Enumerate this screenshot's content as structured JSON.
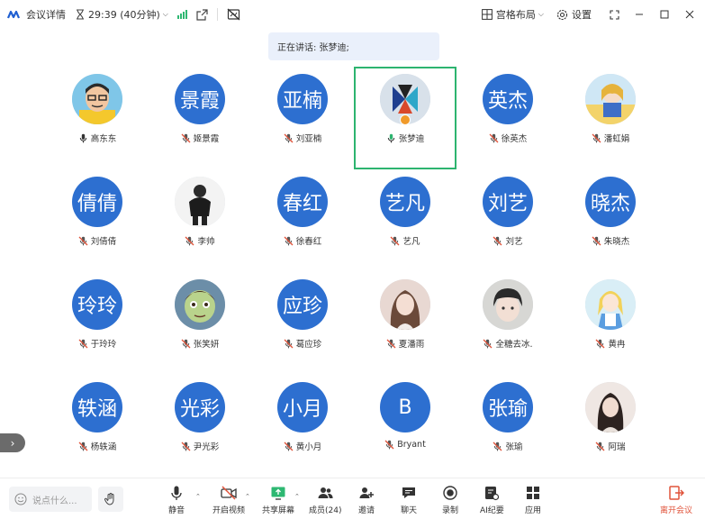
{
  "titlebar": {
    "meeting_details": "会议详情",
    "timer": "29:39 (40分钟)",
    "layout_label": "宫格布局",
    "settings_label": "设置"
  },
  "speaking": {
    "text": "正在讲话: 张梦迪;"
  },
  "participants": [
    {
      "name": "高东东",
      "avatar_text": "",
      "avatar_type": "photo-cartoon-man",
      "mic": "on"
    },
    {
      "name": "姬景霞",
      "avatar_text": "景霞",
      "avatar_type": "initials",
      "mic": "muted"
    },
    {
      "name": "刘亚楠",
      "avatar_text": "亚楠",
      "avatar_type": "initials",
      "mic": "muted"
    },
    {
      "name": "张梦迪",
      "avatar_text": "",
      "avatar_type": "photo-logo",
      "mic": "speaking",
      "active": true,
      "host": true
    },
    {
      "name": "徐英杰",
      "avatar_text": "英杰",
      "avatar_type": "initials",
      "mic": "muted"
    },
    {
      "name": "潘虹娟",
      "avatar_text": "",
      "avatar_type": "photo-anime",
      "mic": "muted"
    },
    {
      "name": "刘倩倩",
      "avatar_text": "倩倩",
      "avatar_type": "initials",
      "mic": "muted"
    },
    {
      "name": "李帅",
      "avatar_text": "",
      "avatar_type": "photo-person",
      "mic": "muted"
    },
    {
      "name": "徐春红",
      "avatar_text": "春红",
      "avatar_type": "initials",
      "mic": "muted"
    },
    {
      "name": "艺凡",
      "avatar_text": "艺凡",
      "avatar_type": "initials",
      "mic": "muted"
    },
    {
      "name": "刘艺",
      "avatar_text": "刘艺",
      "avatar_type": "initials",
      "mic": "muted"
    },
    {
      "name": "朱晓杰",
      "avatar_text": "晓杰",
      "avatar_type": "initials",
      "mic": "muted"
    },
    {
      "name": "于玲玲",
      "avatar_text": "玲玲",
      "avatar_type": "initials",
      "mic": "muted"
    },
    {
      "name": "张笑妍",
      "avatar_text": "",
      "avatar_type": "photo-cartoon-girl",
      "mic": "muted"
    },
    {
      "name": "葛应珍",
      "avatar_text": "应珍",
      "avatar_type": "initials",
      "mic": "muted"
    },
    {
      "name": "夏潘雨",
      "avatar_text": "",
      "avatar_type": "photo-woman",
      "mic": "muted"
    },
    {
      "name": "全糖去冰.",
      "avatar_text": "",
      "avatar_type": "photo-child",
      "mic": "muted"
    },
    {
      "name": "黄冉",
      "avatar_text": "",
      "avatar_type": "photo-alice",
      "mic": "muted"
    },
    {
      "name": "杨轶涵",
      "avatar_text": "轶涵",
      "avatar_type": "initials",
      "mic": "muted"
    },
    {
      "name": "尹光彩",
      "avatar_text": "光彩",
      "avatar_type": "initials",
      "mic": "muted"
    },
    {
      "name": "黄小月",
      "avatar_text": "小月",
      "avatar_type": "initials",
      "mic": "muted"
    },
    {
      "name": "Bryant",
      "avatar_text": "B",
      "avatar_type": "initials",
      "mic": "muted"
    },
    {
      "name": "张瑜",
      "avatar_text": "张瑜",
      "avatar_type": "initials",
      "mic": "muted"
    },
    {
      "name": "阿瑞",
      "avatar_text": "",
      "avatar_type": "photo-girl",
      "mic": "muted"
    }
  ],
  "toolbar": {
    "chat_placeholder": "说点什么...",
    "mute": "静音",
    "video": "开启视频",
    "share": "共享屏幕",
    "members": "成员(24)",
    "invite": "邀请",
    "chat": "聊天",
    "record": "录制",
    "ai_notes": "AI纪要",
    "apps": "应用",
    "leave": "离开会议"
  },
  "colors": {
    "avatar_blue": "#2d6fd0",
    "active_border": "#2db46f",
    "leave_red": "#e0533a",
    "banner_bg": "#eaf0fb"
  }
}
